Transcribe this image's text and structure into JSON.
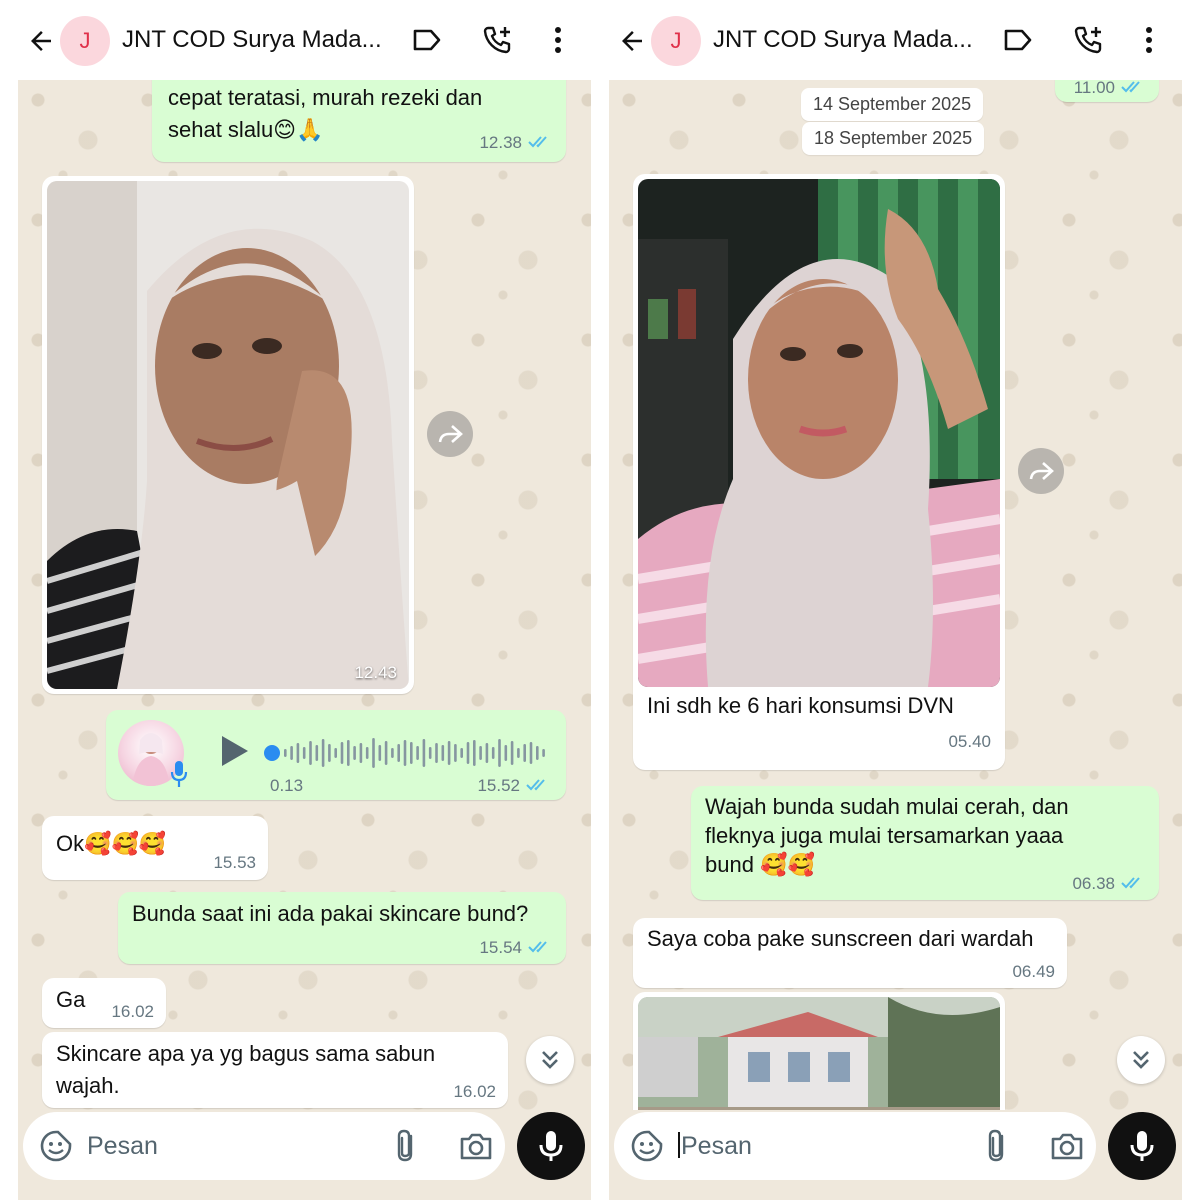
{
  "left": {
    "header": {
      "avatar_letter": "J",
      "title": "JNT COD Surya Mada..."
    },
    "messages": {
      "m1": {
        "text_line1": "cepat teratasi, murah rezeki dan",
        "text_line2": "sehat slalu😊🙏",
        "time": "12.38"
      },
      "m2": {
        "time": "12.43"
      },
      "m3": {
        "duration": "0.13",
        "time": "15.52"
      },
      "m4": {
        "text": "Ok🥰🥰🥰",
        "time": "15.53"
      },
      "m5": {
        "text": "Bunda saat ini ada pakai skincare bund?",
        "time": "15.54"
      },
      "m6": {
        "text": "Ga",
        "time": "16.02"
      },
      "m7": {
        "text_line1": "Skincare apa ya yg bagus sama sabun",
        "text_line2": "wajah.",
        "time": "16.02"
      }
    },
    "composer": {
      "placeholder": "Pesan"
    }
  },
  "right": {
    "header": {
      "avatar_letter": "J",
      "title": "JNT COD Surya Mada..."
    },
    "messages": {
      "m0": {
        "time": "11.00"
      },
      "date1": "14 September 2025",
      "date2": "18 September 2025",
      "m1": {
        "caption": "Ini sdh ke 6 hari konsumsi DVN",
        "time": "05.40"
      },
      "m2": {
        "text_line1": "Wajah bunda sudah mulai cerah, dan",
        "text_line2": "fleknya juga mulai tersamarkan yaaa",
        "text_line3": "bund 🥰🥰",
        "time": "06.38"
      },
      "m3": {
        "text": "Saya coba pake sunscreen dari wardah",
        "time": "06.49"
      }
    },
    "composer": {
      "placeholder": "Pesan"
    }
  },
  "colors": {
    "outgoing_bubble": "#d9fdd3",
    "incoming_bubble": "#ffffff",
    "chat_background": "#efe8dc",
    "read_ticks": "#53bdeb",
    "avatar_bg": "#fbd7dd",
    "avatar_letter": "#e0304a"
  },
  "icons": {
    "back": "arrow-left-icon",
    "label": "label-icon",
    "call": "add-call-icon",
    "more": "more-vertical-icon",
    "forward": "forward-icon",
    "scroll_down": "double-chevron-down-icon",
    "emoji": "sticker-icon",
    "attach": "paperclip-icon",
    "camera": "camera-icon",
    "mic": "mic-icon",
    "play": "play-icon"
  }
}
